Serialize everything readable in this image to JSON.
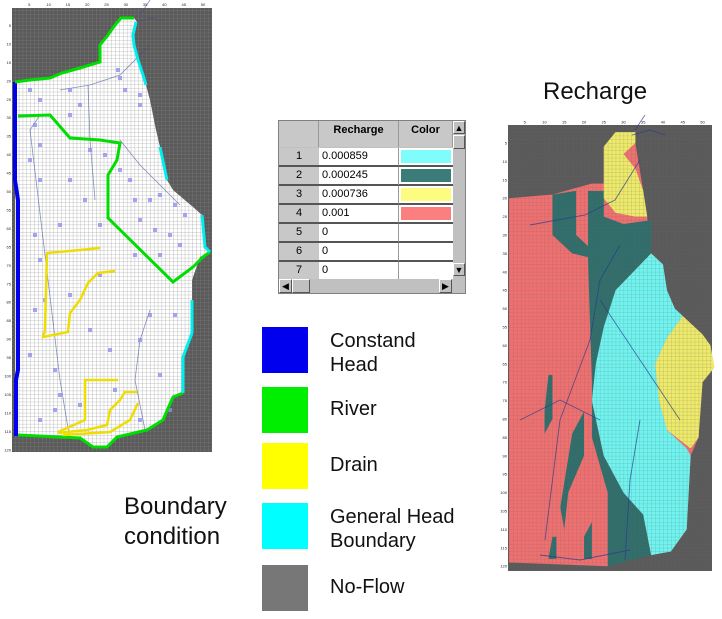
{
  "titles": {
    "recharge": "Recharge",
    "boundary_condition_line1": "Boundary",
    "boundary_condition_line2": "condition"
  },
  "axis_ticks": {
    "columns": [
      "5",
      "10",
      "15",
      "20",
      "25",
      "30",
      "35",
      "40",
      "45",
      "50"
    ],
    "rows": [
      "5",
      "10",
      "15",
      "20",
      "25",
      "30",
      "35",
      "40",
      "45",
      "50",
      "55",
      "60",
      "65",
      "70",
      "75",
      "80",
      "85",
      "90",
      "95",
      "100",
      "105",
      "110",
      "115",
      "120"
    ]
  },
  "recharge_table": {
    "headers": {
      "recharge": "Recharge",
      "color": "Color"
    },
    "rows": [
      {
        "id": "1",
        "recharge": "0.000859",
        "color": "#7ffcfc"
      },
      {
        "id": "2",
        "recharge": "0.000245",
        "color": "#3b7b78"
      },
      {
        "id": "3",
        "recharge": "0.000736",
        "color": "#fcfc7f"
      },
      {
        "id": "4",
        "recharge": "0.001",
        "color": "#fc7f7f"
      },
      {
        "id": "5",
        "recharge": "0",
        "color": "#ffffff"
      },
      {
        "id": "6",
        "recharge": "0",
        "color": "#ffffff"
      },
      {
        "id": "7",
        "recharge": "0",
        "color": "#ffffff"
      }
    ],
    "scroll_icons": [
      "arrow-up-icon",
      "arrow-down-icon",
      "arrow-left-icon",
      "arrow-right-icon"
    ]
  },
  "legend": [
    {
      "line1": "Constand",
      "line2": "Head",
      "color": "#0000ee"
    },
    {
      "line1": "River",
      "line2": "",
      "color": "#00ee00"
    },
    {
      "line1": "Drain",
      "line2": "",
      "color": "#ffff00"
    },
    {
      "line1": "General Head",
      "line2": "Boundary",
      "color": "#00ffff"
    },
    {
      "line1": "No-Flow",
      "line2": "",
      "color": "#777777"
    }
  ],
  "colors": {
    "no_flow": "#5a5a5a",
    "active_cell": "#ffffff",
    "well": "#8f8fef",
    "stream": "#3a4a9a"
  }
}
